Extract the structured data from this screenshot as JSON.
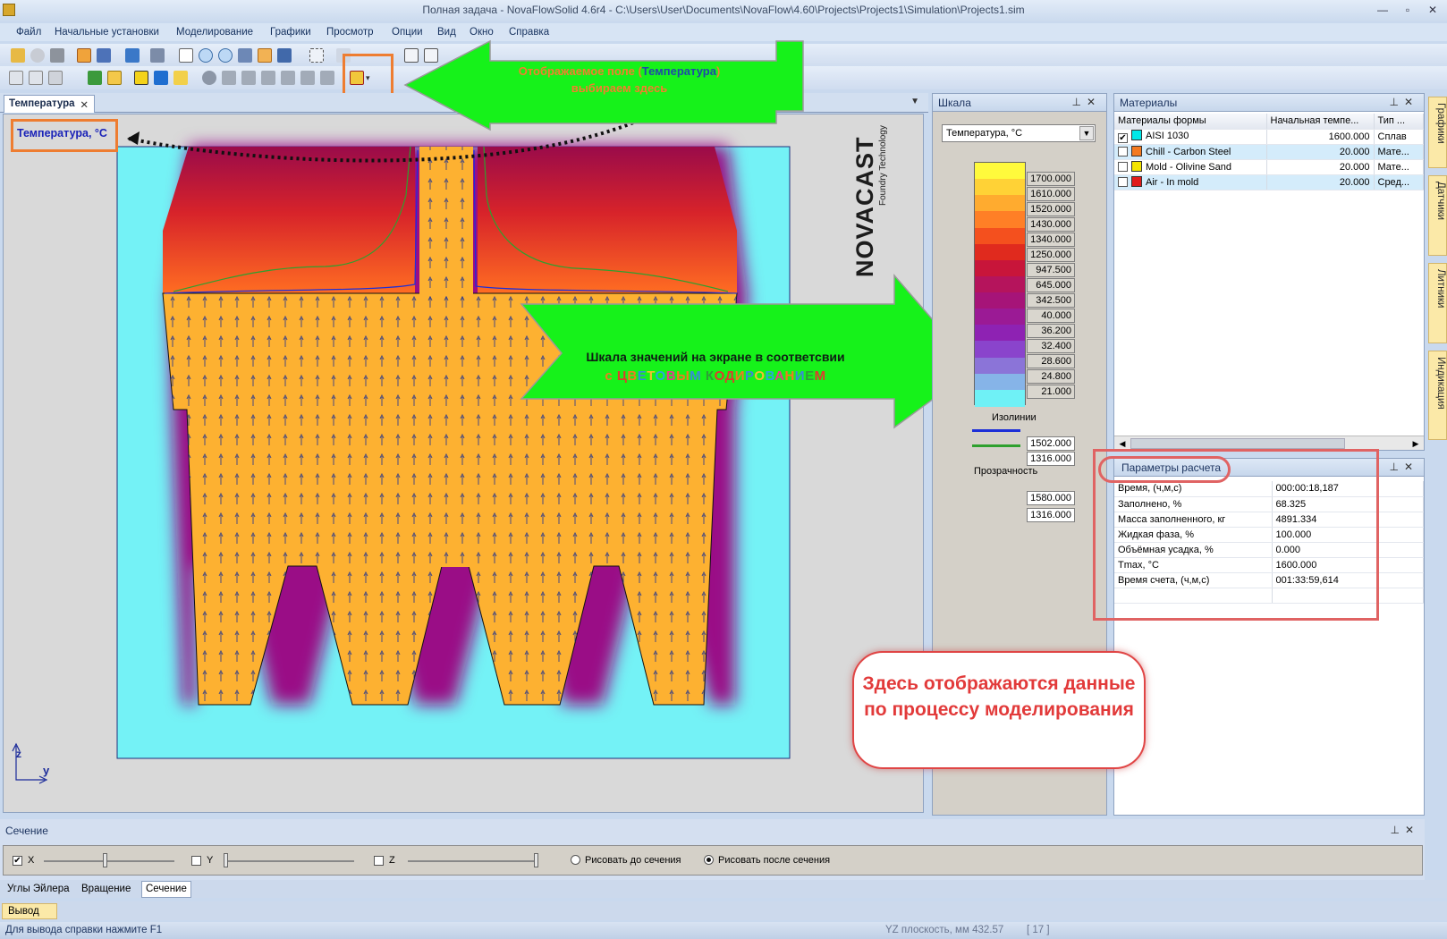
{
  "window": {
    "title": "Полная задача - NovaFlowSolid 4.6r4 - C:\\Users\\User\\Documents\\NovaFlow\\4.60\\Projects\\Projects1\\Simulation\\Projects1.sim"
  },
  "menu": [
    "Файл",
    "Начальные установки",
    "Моделирование",
    "Графики",
    "Просмотр",
    "Опции",
    "Вид",
    "Окно",
    "Справка"
  ],
  "view_tab": {
    "label": "Температура"
  },
  "viewport": {
    "field_label": "Температура, °C",
    "logo": "NOVACAST",
    "logo_sub": "Foundry Technology",
    "axis_z": "z",
    "axis_y": "y"
  },
  "annotations": {
    "top_arrow_line1_a": "Отображаемое поле (",
    "top_arrow_line1_b": "Температура",
    "top_arrow_line1_c": ")",
    "top_arrow_line2": "выбираем здесь",
    "mid_arrow_line1": "Шкала значений  на экране в соответсвии",
    "mid_arrow_prefix": "с ",
    "mid_arrow_colored": "ЦВЕТОВЫМ КОДИРОВАНИЕМ",
    "callout": "Здесь отображаются данные по процессу моделирования"
  },
  "scale_panel": {
    "title": "Шкала",
    "field_select": "Температура, °C",
    "values": [
      "1700.000",
      "1610.000",
      "1520.000",
      "1430.000",
      "1340.000",
      "1250.000",
      "947.500",
      "645.000",
      "342.500",
      "40.000",
      "36.200",
      "32.400",
      "28.600",
      "24.800",
      "21.000"
    ],
    "colors": [
      "#fffa3c",
      "#ffd236",
      "#ffab2f",
      "#ff7f26",
      "#f4501e",
      "#e02a1e",
      "#c8153a",
      "#b5145c",
      "#a61478",
      "#9b1a95",
      "#8e22b3",
      "#8a44cc",
      "#8b74d8",
      "#86b4e8",
      "#6ff1f6"
    ],
    "isolines_label": "Изолинии",
    "isolines": [
      {
        "value": "1502.000",
        "color": "#1d2fd8"
      },
      {
        "value": "1316.000",
        "color": "#2ea02e"
      }
    ],
    "transparency_label": "Прозрачность",
    "transparency": [
      "1580.000",
      "1316.000"
    ]
  },
  "materials_panel": {
    "title": "Материалы",
    "columns": [
      "Материалы формы",
      "Начальная темпе...",
      "Тип ..."
    ],
    "rows": [
      {
        "checked": "✔",
        "color": "#00e8e8",
        "name": "AISI 1030",
        "temp": "1600.000",
        "type": "Сплав"
      },
      {
        "checked": "",
        "color": "#f47a20",
        "name": "Chill - Carbon Steel",
        "temp": "20.000",
        "type": "Мате..."
      },
      {
        "checked": "",
        "color": "#f4e400",
        "name": "Mold - Olivine Sand",
        "temp": "20.000",
        "type": "Мате..."
      },
      {
        "checked": "",
        "color": "#e01b1b",
        "name": "Air - In mold",
        "temp": "20.000",
        "type": "Сред..."
      }
    ]
  },
  "params_panel": {
    "title": "Параметры расчета",
    "rows": [
      {
        "label": "Время, (ч,м,с)",
        "value": "000:00:18,187"
      },
      {
        "label": "Заполнено, %",
        "value": "68.325"
      },
      {
        "label": "Масса заполненного, кг",
        "value": "4891.334"
      },
      {
        "label": "Жидкая фаза, %",
        "value": "100.000"
      },
      {
        "label": "Объёмная усадка, %",
        "value": "0.000"
      },
      {
        "label": "Tmax, °C",
        "value": "1600.000"
      },
      {
        "label": "Время счета, (ч,м,с)",
        "value": "001:33:59,614"
      }
    ]
  },
  "side_tabs": [
    "Графики",
    "Датчики",
    "Литники",
    "Индикация"
  ],
  "section_panel": {
    "title": "Сечение",
    "x_label": "X",
    "y_label": "Y",
    "z_label": "Z",
    "x_checked": "✔",
    "x_slider_level": 0.47,
    "y_slider_level": 0.0,
    "z_slider_level": 1.0,
    "radio_before": "Рисовать до сечения",
    "radio_after": "Рисовать после сечения"
  },
  "bottom_tabs": [
    "Углы Эйлера",
    "Вращение",
    "Сечение"
  ],
  "output_tab": "Вывод",
  "status": {
    "help": "Для вывода справки нажмите F1",
    "plane": "YZ плоскость, мм  432.57",
    "count": "[ 17 ]"
  }
}
